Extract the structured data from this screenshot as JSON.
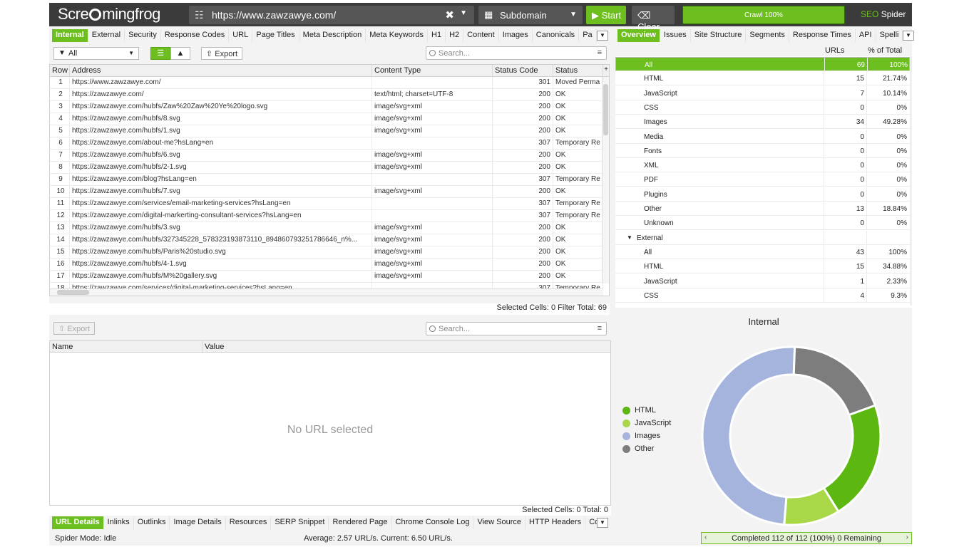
{
  "app": {
    "logo": "Scre",
    "logo_rest": "mingfrog",
    "brand_a": "SEO",
    "brand_b": "Spider"
  },
  "toolbar": {
    "url": "https://www.zawzawye.com/",
    "mode": "Subdomain",
    "start_label": "Start",
    "clear_label": "Clear",
    "crawl_progress_label": "Crawl 100%",
    "crawl_progress": 1.0
  },
  "left_tabs": [
    "Internal",
    "External",
    "Security",
    "Response Codes",
    "URL",
    "Page Titles",
    "Meta Description",
    "Meta Keywords",
    "H1",
    "H2",
    "Content",
    "Images",
    "Canonicals",
    "Pa"
  ],
  "right_tabs": [
    "Overview",
    "Issues",
    "Site Structure",
    "Segments",
    "Response Times",
    "API",
    "Spelli"
  ],
  "filter": {
    "selected": "All",
    "export_label": "Export",
    "search_placeholder": "Search..."
  },
  "grid": {
    "columns": [
      "Row",
      "Address",
      "Content Type",
      "Status Code",
      "Status"
    ],
    "rows": [
      {
        "row": "1",
        "address": "https://www.zawzawye.com/",
        "type": "",
        "code": "301",
        "status": "Moved Perma"
      },
      {
        "row": "2",
        "address": "https://zawzawye.com/",
        "type": "text/html; charset=UTF-8",
        "code": "200",
        "status": "OK"
      },
      {
        "row": "3",
        "address": "https://zawzawye.com/hubfs/Zaw%20Zaw%20Ye%20logo.svg",
        "type": "image/svg+xml",
        "code": "200",
        "status": "OK"
      },
      {
        "row": "4",
        "address": "https://zawzawye.com/hubfs/8.svg",
        "type": "image/svg+xml",
        "code": "200",
        "status": "OK"
      },
      {
        "row": "5",
        "address": "https://zawzawye.com/hubfs/1.svg",
        "type": "image/svg+xml",
        "code": "200",
        "status": "OK"
      },
      {
        "row": "6",
        "address": "https://zawzawye.com/about-me?hsLang=en",
        "type": "",
        "code": "307",
        "status": "Temporary Re"
      },
      {
        "row": "7",
        "address": "https://zawzawye.com/hubfs/6.svg",
        "type": "image/svg+xml",
        "code": "200",
        "status": "OK"
      },
      {
        "row": "8",
        "address": "https://zawzawye.com/hubfs/2-1.svg",
        "type": "image/svg+xml",
        "code": "200",
        "status": "OK"
      },
      {
        "row": "9",
        "address": "https://zawzawye.com/blog?hsLang=en",
        "type": "",
        "code": "307",
        "status": "Temporary Re"
      },
      {
        "row": "10",
        "address": "https://zawzawye.com/hubfs/7.svg",
        "type": "image/svg+xml",
        "code": "200",
        "status": "OK"
      },
      {
        "row": "11",
        "address": "https://zawzawye.com/services/email-marketing-services?hsLang=en",
        "type": "",
        "code": "307",
        "status": "Temporary Re"
      },
      {
        "row": "12",
        "address": "https://zawzawye.com/digital-markerting-consultant-services?hsLang=en",
        "type": "",
        "code": "307",
        "status": "Temporary Re"
      },
      {
        "row": "13",
        "address": "https://zawzawye.com/hubfs/3.svg",
        "type": "image/svg+xml",
        "code": "200",
        "status": "OK"
      },
      {
        "row": "14",
        "address": "https://zawzawye.com/hubfs/327345228_578323193873110_894860793251786646_n%...",
        "type": "image/svg+xml",
        "code": "200",
        "status": "OK"
      },
      {
        "row": "15",
        "address": "https://zawzawye.com/hubfs/Paris%20studio.svg",
        "type": "image/svg+xml",
        "code": "200",
        "status": "OK"
      },
      {
        "row": "16",
        "address": "https://zawzawye.com/hubfs/4-1.svg",
        "type": "image/svg+xml",
        "code": "200",
        "status": "OK"
      },
      {
        "row": "17",
        "address": "https://zawzawye.com/hubfs/M%20gallery.svg",
        "type": "image/svg+xml",
        "code": "200",
        "status": "OK"
      },
      {
        "row": "18",
        "address": "https://zawzawye.com/services/digital-marketing-services?hsLang=en",
        "type": "",
        "code": "307",
        "status": "Temporary Re"
      }
    ],
    "status_text": "Selected Cells:  0  Filter Total:  69"
  },
  "lower": {
    "export_label": "Export",
    "search_placeholder": "Search...",
    "columns": [
      "Name",
      "Value"
    ],
    "empty_text": "No URL selected",
    "status_text": "Selected Cells:  0  Total:  0"
  },
  "bottom_tabs": [
    "URL Details",
    "Inlinks",
    "Outlinks",
    "Image Details",
    "Resources",
    "SERP Snippet",
    "Rendered Page",
    "Chrome Console Log",
    "View Source",
    "HTTP Headers",
    "Co"
  ],
  "overview": {
    "col_urls": "URLs",
    "col_pct": "% of Total",
    "rows": [
      {
        "name": "All",
        "urls": "69",
        "pct": "100%",
        "selected": true
      },
      {
        "name": "HTML",
        "urls": "15",
        "pct": "21.74%"
      },
      {
        "name": "JavaScript",
        "urls": "7",
        "pct": "10.14%"
      },
      {
        "name": "CSS",
        "urls": "0",
        "pct": "0%"
      },
      {
        "name": "Images",
        "urls": "34",
        "pct": "49.28%"
      },
      {
        "name": "Media",
        "urls": "0",
        "pct": "0%"
      },
      {
        "name": "Fonts",
        "urls": "0",
        "pct": "0%"
      },
      {
        "name": "XML",
        "urls": "0",
        "pct": "0%"
      },
      {
        "name": "PDF",
        "urls": "0",
        "pct": "0%"
      },
      {
        "name": "Plugins",
        "urls": "0",
        "pct": "0%"
      },
      {
        "name": "Other",
        "urls": "13",
        "pct": "18.84%"
      },
      {
        "name": "Unknown",
        "urls": "0",
        "pct": "0%"
      },
      {
        "name": "External",
        "urls": "",
        "pct": "",
        "group": true
      },
      {
        "name": "All",
        "urls": "43",
        "pct": "100%"
      },
      {
        "name": "HTML",
        "urls": "15",
        "pct": "34.88%"
      },
      {
        "name": "JavaScript",
        "urls": "1",
        "pct": "2.33%"
      },
      {
        "name": "CSS",
        "urls": "4",
        "pct": "9.3%"
      }
    ]
  },
  "chart_data": {
    "type": "pie",
    "title": "Internal",
    "categories": [
      "HTML",
      "JavaScript",
      "Images",
      "Other"
    ],
    "values": [
      15,
      7,
      34,
      13
    ],
    "colors": [
      "#5cb811",
      "#a8d848",
      "#a4b4dc",
      "#7d7d7d"
    ],
    "legend": "left"
  },
  "footer": {
    "mode": "Spider Mode: Idle",
    "rate": "Average: 2.57 URL/s. Current: 6.50 URL/s.",
    "progress": "Completed 112 of 112 (100%) 0 Remaining"
  }
}
